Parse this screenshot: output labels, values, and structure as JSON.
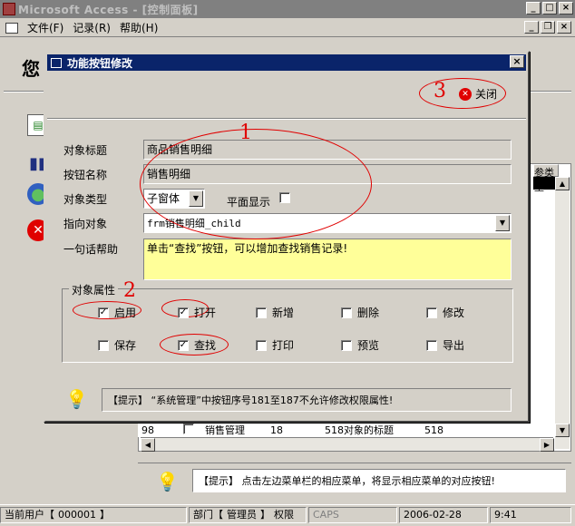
{
  "app": {
    "title": "Microsoft Access - [控制面板]"
  },
  "menu": {
    "items": [
      "文件(F)",
      "记录(R)",
      "帮助(H)"
    ]
  },
  "background": {
    "header_text": "您",
    "col_header": "参类型",
    "row": {
      "num": "98",
      "name": "销售管理",
      "n": "18",
      "title": "518对象的标题",
      "id": "518"
    },
    "hint_label": "【提示】",
    "hint_text": "点击左边菜单栏的相应菜单，将显示相应菜单的对应按钮!"
  },
  "status": {
    "user_label": "当前用户【",
    "user_id": "000001",
    "user_end": "】",
    "dept_label": "部门【",
    "dept": "管理员",
    "dept_end": "】",
    "perm": "权限",
    "caps": "CAPS",
    "date": "2006-02-28",
    "time": "9:41"
  },
  "dialog": {
    "title": "功能按钮修改",
    "close_label": "关闭",
    "fields": {
      "obj_title_label": "对象标题",
      "obj_title_value": "商品销售明细",
      "btn_name_label": "按钮名称",
      "btn_name_value": "销售明细",
      "obj_type_label": "对象类型",
      "obj_type_value": "子窗体",
      "flat_label": "平面显示",
      "target_label": "指向对象",
      "target_value": "frm销售明细_child",
      "help_label": "一句话帮助",
      "help_value": "单击“查找”按钮，可以增加查找销售记录!"
    },
    "group_label": "对象属性",
    "props": [
      {
        "label": "启用",
        "checked": true
      },
      {
        "label": "打开",
        "checked": true
      },
      {
        "label": "新增",
        "checked": false
      },
      {
        "label": "删除",
        "checked": false
      },
      {
        "label": "修改",
        "checked": false
      },
      {
        "label": "保存",
        "checked": false
      },
      {
        "label": "查找",
        "checked": true
      },
      {
        "label": "打印",
        "checked": false
      },
      {
        "label": "预览",
        "checked": false
      },
      {
        "label": "导出",
        "checked": false
      }
    ],
    "hint": {
      "label": "【提示】",
      "text": "“系统管理”中按钮序号181至187不允许修改权限属性!"
    },
    "annotations": [
      "1",
      "2",
      "3"
    ]
  },
  "colors": {
    "title_active": "#0a246a",
    "annotation": "#e00000",
    "help_bg": "#ffff99"
  }
}
